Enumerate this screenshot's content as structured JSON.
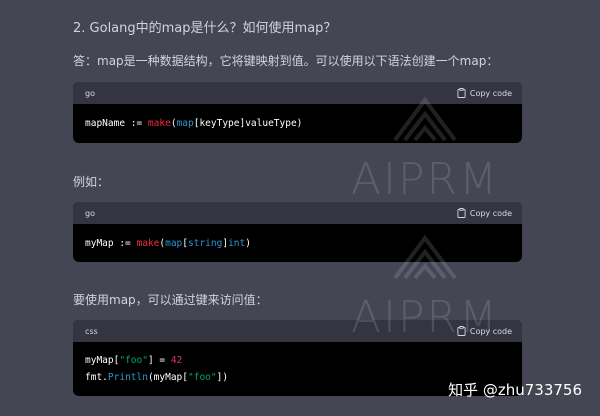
{
  "question": {
    "number": "2.",
    "text": "Golang中的map是什么？如何使用map？"
  },
  "answer_intro": "答：map是一种数据结构，它将键映射到值。可以使用以下语法创建一个map：",
  "example_label": "例如：",
  "access_label": "要使用map，可以通过键来访问值：",
  "copy_label": "Copy code",
  "code_blocks": [
    {
      "language": "go",
      "lines": [
        [
          {
            "t": "mapName := ",
            "c": "plain"
          },
          {
            "t": "make",
            "c": "fn"
          },
          {
            "t": "(",
            "c": "plain"
          },
          {
            "t": "map",
            "c": "type"
          },
          {
            "t": "[keyType]valueType)",
            "c": "plain"
          }
        ]
      ]
    },
    {
      "language": "go",
      "lines": [
        [
          {
            "t": "myMap := ",
            "c": "plain"
          },
          {
            "t": "make",
            "c": "fn"
          },
          {
            "t": "(",
            "c": "plain"
          },
          {
            "t": "map",
            "c": "type"
          },
          {
            "t": "[",
            "c": "plain"
          },
          {
            "t": "string",
            "c": "type"
          },
          {
            "t": "]",
            "c": "plain"
          },
          {
            "t": "int",
            "c": "type"
          },
          {
            "t": ")",
            "c": "plain"
          }
        ]
      ]
    },
    {
      "language": "css",
      "lines": [
        [
          {
            "t": "myMap[",
            "c": "plain"
          },
          {
            "t": "\"foo\"",
            "c": "str"
          },
          {
            "t": "] = ",
            "c": "plain"
          },
          {
            "t": "42",
            "c": "num"
          }
        ],
        [
          {
            "t": "fmt",
            "c": "plain"
          },
          {
            "t": ".",
            "c": "plain"
          },
          {
            "t": "Println",
            "c": "type"
          },
          {
            "t": "(myMap[",
            "c": "plain"
          },
          {
            "t": "\"foo\"",
            "c": "str"
          },
          {
            "t": "])",
            "c": "plain"
          }
        ]
      ]
    }
  ],
  "watermark_text": "AIPRM",
  "credit": "知乎 @zhu733756",
  "colors": {
    "page_bg": "#444654",
    "code_header_bg": "#343541",
    "code_body_bg": "#000000",
    "fn": "#f22c3d",
    "type": "#2e95d3",
    "str": "#00a67d",
    "num": "#df3079"
  }
}
